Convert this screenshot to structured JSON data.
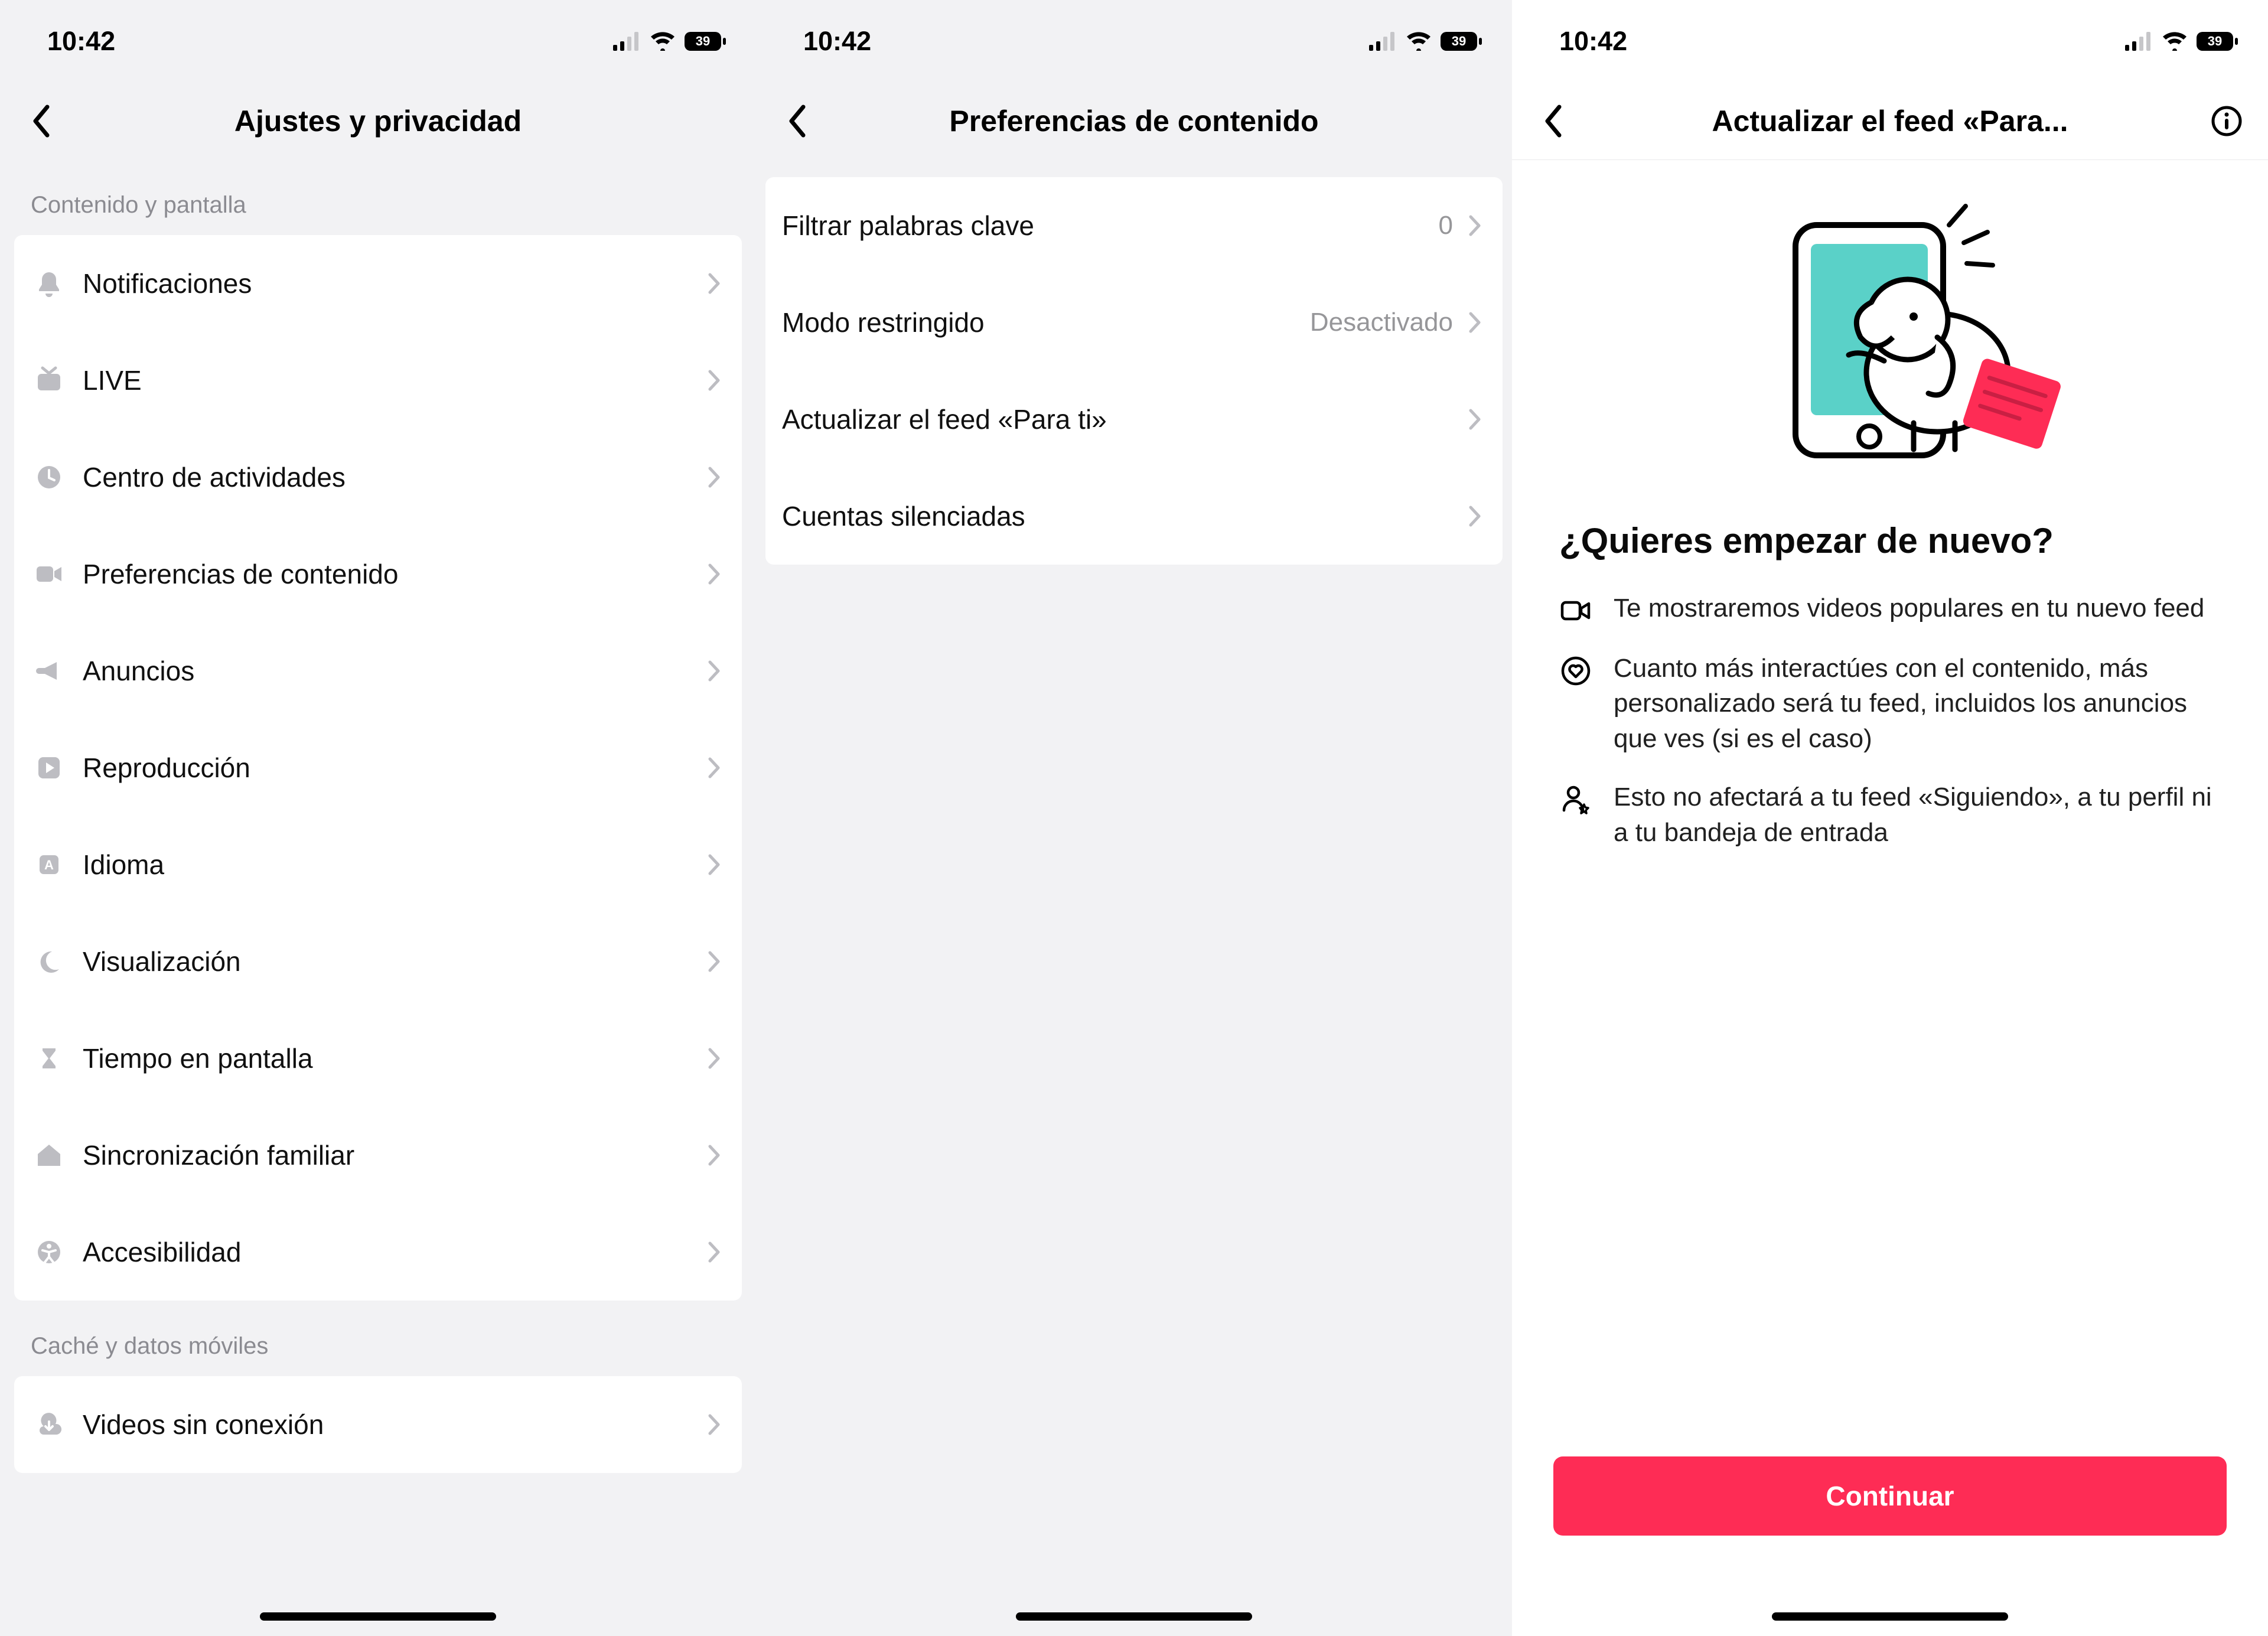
{
  "status": {
    "time": "10:42",
    "battery": "39"
  },
  "screen1": {
    "title": "Ajustes y privacidad",
    "section_a": "Contenido y pantalla",
    "items_a": [
      {
        "label": "Notificaciones"
      },
      {
        "label": "LIVE"
      },
      {
        "label": "Centro de actividades"
      },
      {
        "label": "Preferencias de contenido"
      },
      {
        "label": "Anuncios"
      },
      {
        "label": "Reproducción"
      },
      {
        "label": "Idioma"
      },
      {
        "label": "Visualización"
      },
      {
        "label": "Tiempo en pantalla"
      },
      {
        "label": "Sincronización familiar"
      },
      {
        "label": "Accesibilidad"
      }
    ],
    "section_b": "Caché y datos móviles",
    "items_b": [
      {
        "label": "Videos sin conexión"
      }
    ]
  },
  "screen2": {
    "title": "Preferencias de contenido",
    "items": [
      {
        "label": "Filtrar palabras clave",
        "value": "0"
      },
      {
        "label": "Modo restringido",
        "value": "Desactivado"
      },
      {
        "label": "Actualizar el feed «Para ti»",
        "value": ""
      },
      {
        "label": "Cuentas silenciadas",
        "value": ""
      }
    ]
  },
  "screen3": {
    "title": "Actualizar el feed «Para...",
    "heading": "¿Quieres empezar de nuevo?",
    "bullets": [
      "Te mostraremos videos populares en tu nuevo feed",
      "Cuanto más interactúes con el contenido, más personalizado será tu feed, incluidos los anuncios que ves (si es el caso)",
      "Esto no afectará a tu feed «Siguiendo», a tu perfil ni a tu bandeja de entrada"
    ],
    "cta": "Continuar"
  },
  "colors": {
    "primary": "#fe2c55",
    "teal": "#5ad1c8"
  }
}
